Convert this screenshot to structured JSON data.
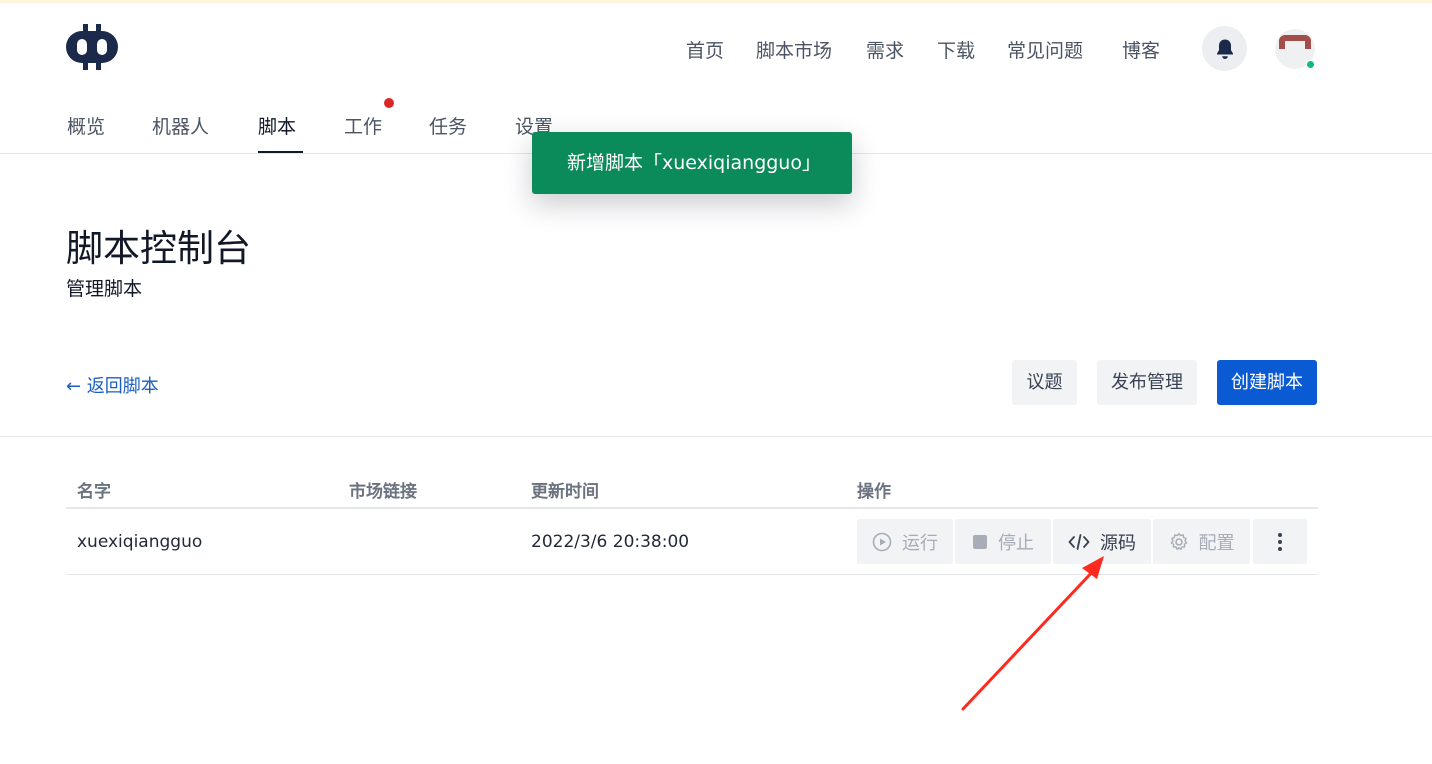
{
  "header": {
    "nav": [
      "首页",
      "脚本市场",
      "需求",
      "下载",
      "常见问题",
      "博客"
    ]
  },
  "tabs": [
    "概览",
    "机器人",
    "脚本",
    "工作",
    "任务",
    "设置"
  ],
  "toast": {
    "message": "新增脚本「xuexiqiangguo」"
  },
  "page": {
    "title": "脚本控制台",
    "subtitle": "管理脚本"
  },
  "actions": {
    "back": "← 返回脚本",
    "issues": "议题",
    "publish": "发布管理",
    "create": "创建脚本"
  },
  "table": {
    "headers": [
      "名字",
      "市场链接",
      "更新时间",
      "操作"
    ],
    "rows": [
      {
        "name": "xuexiqiangguo",
        "market_link": "",
        "updated": "2022/3/6 20:38:00"
      }
    ]
  },
  "ops": {
    "run": "运行",
    "stop": "停止",
    "source": "源码",
    "config": "配置"
  },
  "colors": {
    "toast_bg": "#0b8a5a",
    "primary": "#0a5bd3",
    "link": "#1d5fbf",
    "notification_dot": "#dc2626",
    "online_dot": "#10b981",
    "annotation_arrow": "#ff2a1f"
  },
  "icons": {
    "logo": "robot-logo",
    "bell": "bell-icon",
    "run": "play-circle-icon",
    "stop": "stop-square-icon",
    "source": "code-icon",
    "config": "gear-icon",
    "more": "more-vertical-icon"
  }
}
